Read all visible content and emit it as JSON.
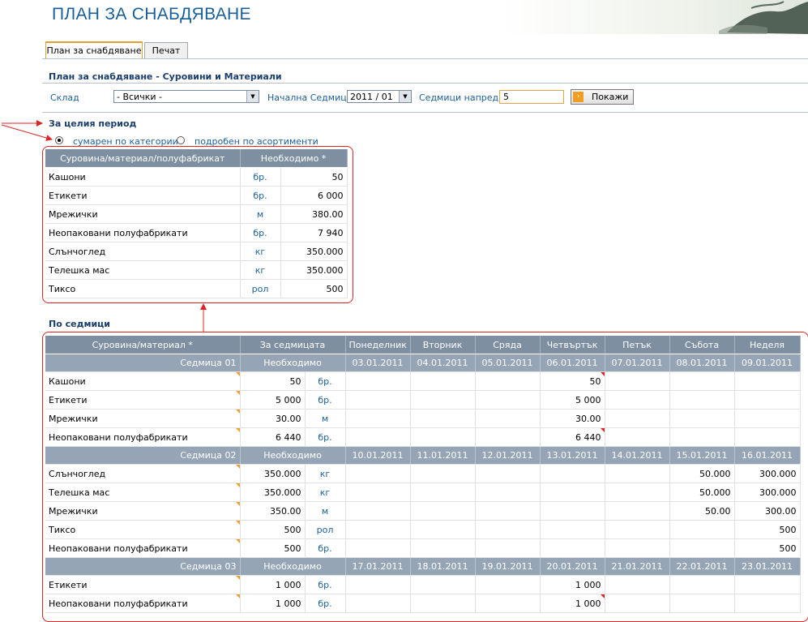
{
  "page": {
    "title": "ПЛАН ЗА СНАБДЯВАНЕ"
  },
  "tabs": [
    {
      "label": "План за снабдяване",
      "active": true
    },
    {
      "label": "Печат",
      "active": false
    }
  ],
  "section_main": "План за снабдяване - Суровини и Материали",
  "filters": {
    "warehouse_label": "Склад",
    "warehouse_value": "- Всички -",
    "start_week_label": "Начална Седмица",
    "start_week_value": "2011 / 01",
    "weeks_ahead_label": "Седмици напред",
    "weeks_ahead_value": "5",
    "show_button": "Покажи"
  },
  "period": {
    "title": "За целия период",
    "option_summary": "сумарен по категории",
    "option_detail": "подробен по асортименти"
  },
  "summary_table": {
    "headers": [
      "Суровина/материал/полуфабрикат",
      "Необходимо *"
    ],
    "rows": [
      {
        "name": "Кашони",
        "unit": "бр.",
        "qty": "50"
      },
      {
        "name": "Етикети",
        "unit": "бр.",
        "qty": "6 000"
      },
      {
        "name": "Мрежички",
        "unit": "м",
        "qty": "380.00"
      },
      {
        "name": "Неопаковани полуфабрикати",
        "unit": "бр.",
        "qty": "7 940"
      },
      {
        "name": "Слънчоглед",
        "unit": "кг",
        "qty": "350.000"
      },
      {
        "name": "Телешка мас",
        "unit": "кг",
        "qty": "350.000"
      },
      {
        "name": "Тиксо",
        "unit": "рол",
        "qty": "500"
      }
    ]
  },
  "weekly": {
    "title": "По седмици",
    "headers": [
      "Суровина/материал *",
      "За седмицата",
      "Понеделник",
      "Вторник",
      "Сряда",
      "Четвъртък",
      "Петък",
      "Събота",
      "Неделя"
    ],
    "weeks": [
      {
        "label": "Седмица 01",
        "needed": "Необходимо",
        "dates": [
          "03.01.2011",
          "04.01.2011",
          "05.01.2011",
          "06.01.2011",
          "07.01.2011",
          "08.01.2011",
          "09.01.2011"
        ],
        "rows": [
          {
            "name": "Кашони",
            "qty": "50",
            "unit": "бр.",
            "days": [
              "",
              "",
              "",
              "50",
              "",
              "",
              ""
            ]
          },
          {
            "name": "Етикети",
            "qty": "5 000",
            "unit": "бр.",
            "days": [
              "",
              "",
              "",
              "5 000",
              "",
              "",
              ""
            ]
          },
          {
            "name": "Мрежички",
            "qty": "30.00",
            "unit": "м",
            "days": [
              "",
              "",
              "",
              "30.00",
              "",
              "",
              ""
            ]
          },
          {
            "name": "Неопаковани полуфабрикати",
            "qty": "6 440",
            "unit": "бр.",
            "days": [
              "",
              "",
              "",
              "6 440",
              "",
              "",
              ""
            ]
          }
        ]
      },
      {
        "label": "Седмица 02",
        "needed": "Необходимо",
        "dates": [
          "10.01.2011",
          "11.01.2011",
          "12.01.2011",
          "13.01.2011",
          "14.01.2011",
          "15.01.2011",
          "16.01.2011"
        ],
        "rows": [
          {
            "name": "Слънчоглед",
            "qty": "350.000",
            "unit": "кг",
            "days": [
              "",
              "",
              "",
              "",
              "",
              "50.000",
              "300.000"
            ]
          },
          {
            "name": "Телешка мас",
            "qty": "350.000",
            "unit": "кг",
            "days": [
              "",
              "",
              "",
              "",
              "",
              "50.000",
              "300.000"
            ]
          },
          {
            "name": "Мрежички",
            "qty": "350.00",
            "unit": "м",
            "days": [
              "",
              "",
              "",
              "",
              "",
              "50.00",
              "300.00"
            ]
          },
          {
            "name": "Тиксо",
            "qty": "500",
            "unit": "рол",
            "days": [
              "",
              "",
              "",
              "",
              "",
              "",
              "500"
            ]
          },
          {
            "name": "Неопаковани полуфабрикати",
            "qty": "500",
            "unit": "бр.",
            "days": [
              "",
              "",
              "",
              "",
              "",
              "",
              "500"
            ]
          }
        ]
      },
      {
        "label": "Седмица 03",
        "needed": "Необходимо",
        "dates": [
          "17.01.2011",
          "18.01.2011",
          "19.01.2011",
          "20.01.2011",
          "21.01.2011",
          "22.01.2011",
          "23.01.2011"
        ],
        "rows": [
          {
            "name": "Етикети",
            "qty": "1 000",
            "unit": "бр.",
            "days": [
              "",
              "",
              "",
              "1 000",
              "",
              "",
              ""
            ]
          },
          {
            "name": "Неопаковани полуфабрикати",
            "qty": "1 000",
            "unit": "бр.",
            "days": [
              "",
              "",
              "",
              "1 000",
              "",
              "",
              ""
            ]
          }
        ]
      }
    ]
  },
  "colors": {
    "accent": "#1a5f9a",
    "annotation": "#e02424",
    "header_bg": "#7d8fa0",
    "tab_active": "#e2a230"
  }
}
